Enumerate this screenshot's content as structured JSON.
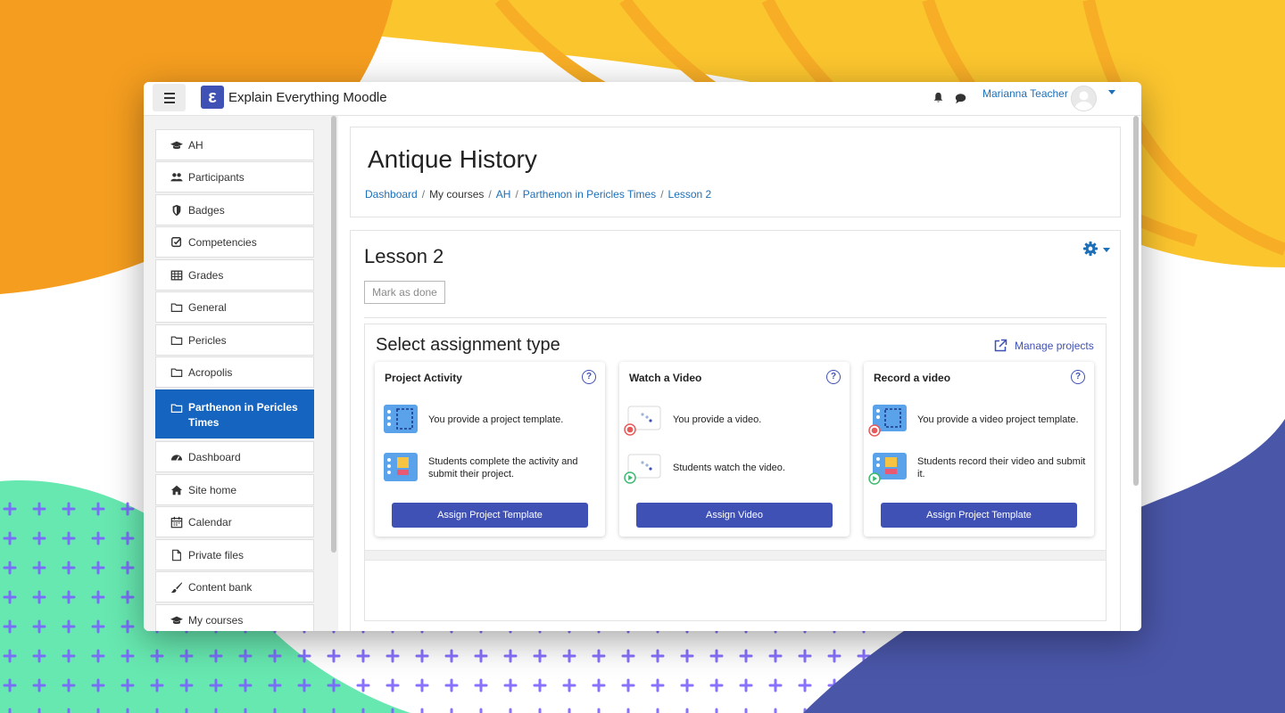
{
  "app": {
    "site_name": "Explain Everything Moodle",
    "logo_glyph": "ε"
  },
  "user": {
    "name": "Marianna Teacher"
  },
  "colors": {
    "primary": "#3f51b5",
    "link": "#1d6fb8",
    "active_nav": "#1565c0"
  },
  "sidebar": {
    "items": [
      {
        "label": "AH",
        "icon": "graduation-cap-icon"
      },
      {
        "label": "Participants",
        "icon": "users-icon"
      },
      {
        "label": "Badges",
        "icon": "shield-icon"
      },
      {
        "label": "Competencies",
        "icon": "checkbox-icon"
      },
      {
        "label": "Grades",
        "icon": "table-icon"
      },
      {
        "label": "General",
        "icon": "folder-icon"
      },
      {
        "label": "Pericles",
        "icon": "folder-icon"
      },
      {
        "label": "Acropolis",
        "icon": "folder-icon"
      },
      {
        "label": "Parthenon in Pericles Times",
        "icon": "folder-icon",
        "active": true
      },
      {
        "label": "Dashboard",
        "icon": "dashboard-icon"
      },
      {
        "label": "Site home",
        "icon": "home-icon"
      },
      {
        "label": "Calendar",
        "icon": "calendar-icon"
      },
      {
        "label": "Private files",
        "icon": "file-icon"
      },
      {
        "label": "Content bank",
        "icon": "brush-icon"
      },
      {
        "label": "My courses",
        "icon": "graduation-cap-icon"
      }
    ]
  },
  "course": {
    "title": "Antique History",
    "breadcrumb": [
      {
        "label": "Dashboard",
        "link": true
      },
      {
        "label": "My courses",
        "link": false
      },
      {
        "label": "AH",
        "link": true
      },
      {
        "label": "Parthenon in Pericles Times",
        "link": true
      },
      {
        "label": "Lesson 2",
        "link": true
      }
    ]
  },
  "lesson": {
    "title": "Lesson 2",
    "mark_done": "Mark as done"
  },
  "assignment": {
    "heading": "Select assignment type",
    "manage_link": "Manage projects",
    "options": [
      {
        "title": "Project Activity",
        "help": "?",
        "row1": "You provide a project template.",
        "row2": "Students complete the activity and submit their project.",
        "button": "Assign Project Template"
      },
      {
        "title": "Watch a Video",
        "help": "?",
        "row1": "You provide a video.",
        "row2": "Students watch the video.",
        "button": "Assign Video"
      },
      {
        "title": "Record a video",
        "help": "?",
        "row1": "You provide a video project template.",
        "row2": "Students record their video and submit it.",
        "button": "Assign Project Template"
      }
    ]
  }
}
